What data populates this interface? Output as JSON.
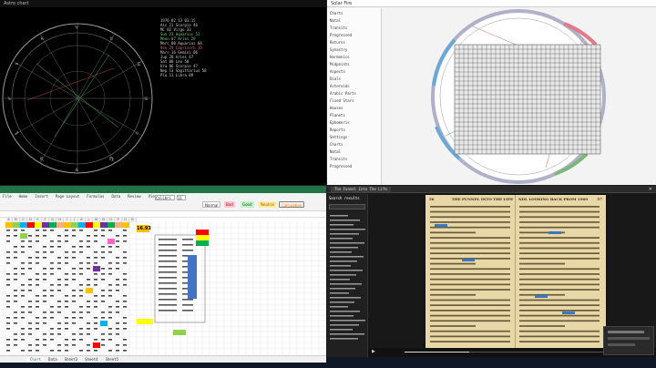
{
  "top_left": {
    "title": "Astro chart",
    "info_lines": [
      "1976 02 13 03:15",
      "Asc 21 Scorpio 46",
      "MC 02 Virgo 33",
      "Sun 23 Aquarius 52",
      "Moon 07 Aries 29",
      "Merc 00 Aquarius 04",
      "Ven 29 Capricorn 15",
      "Mars 16 Gemini 06",
      "Jup 28 Aries 47",
      "Sat 00 Leo 50",
      "Ura 06 Scorpio 47",
      "Nep 13 Sagittarius 58",
      "Plu 11 Libra 09"
    ]
  },
  "top_right": {
    "title": "Solar Fire",
    "side_items": [
      "Charts",
      "Natal",
      "Transits",
      "Progressed",
      "Returns",
      "Synastry",
      "Harmonics",
      "Midpoints",
      "Aspects",
      "Dials",
      "Asteroids",
      "Arabic Parts",
      "Fixed Stars",
      "Houses",
      "Planets",
      "Ephemeris",
      "Reports",
      "Settings"
    ]
  },
  "bottom_left": {
    "ribbon_tabs": [
      "File",
      "Home",
      "Insert",
      "Page Layout",
      "Formulas",
      "Data",
      "Review",
      "View"
    ],
    "font_name": "Calibri",
    "font_size": "11",
    "style_chips": [
      "Normal",
      "Bad",
      "Good",
      "Neutral",
      "Calculation",
      "Check Cell"
    ],
    "header_cols": [
      "A",
      "B",
      "C",
      "D",
      "E",
      "F",
      "G",
      "H",
      "I",
      "J",
      "K",
      "L",
      "M",
      "N",
      "O",
      "P",
      "Q",
      "R"
    ],
    "highlight_value": "16.93",
    "sheet_tabs": [
      "Chart",
      "Data",
      "Sheet3",
      "Sheet4",
      "Sheet5"
    ]
  },
  "bottom_right": {
    "window_title": "The Funnel Into The Life",
    "tab_label": "PDF",
    "page_left_no": "56",
    "page_left_header": "THE FUNNEL INTO THE LIFE",
    "page_right_header": "NDL LOOKING BACK FROM 1960",
    "page_right_no": "57",
    "chat_title": "Search results",
    "zoom": "100%"
  },
  "colors": {
    "excel_green": "#217346",
    "paper": "#e8d7a7",
    "accent": "#2e7bd6"
  }
}
